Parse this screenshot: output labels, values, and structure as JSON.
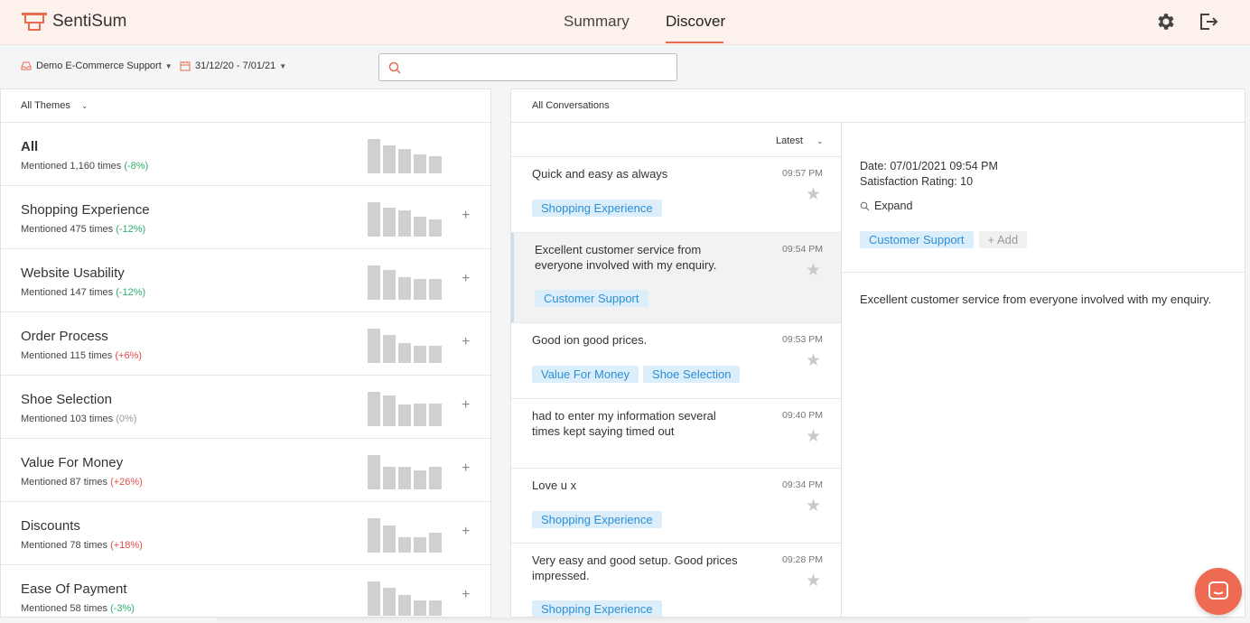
{
  "app": {
    "name": "SentiSum"
  },
  "nav": {
    "tabs": [
      {
        "label": "Summary"
      },
      {
        "label": "Discover"
      }
    ],
    "active": "Discover"
  },
  "filters": {
    "source": "Demo E-Commerce Support",
    "date_range": "31/12/20 - 7/01/21",
    "search_value": "",
    "search_placeholder": ""
  },
  "themes": {
    "header": "All Themes",
    "items": [
      {
        "name": "All",
        "count": "Mentioned 1,160 times",
        "delta": "(-8%)",
        "bars": [
          1.0,
          0.82,
          0.72,
          0.55,
          0.5
        ]
      },
      {
        "name": "Shopping Experience",
        "count": "Mentioned 475 times",
        "delta": "(-12%)",
        "bars": [
          1.0,
          0.85,
          0.75,
          0.58,
          0.5
        ]
      },
      {
        "name": "Website Usability",
        "count": "Mentioned 147 times",
        "delta": "(-12%)",
        "bars": [
          1.0,
          0.88,
          0.66,
          0.6,
          0.6
        ]
      },
      {
        "name": "Order Process",
        "count": "Mentioned 115 times",
        "delta": "(+6%)",
        "bars": [
          1.0,
          0.82,
          0.58,
          0.5,
          0.5
        ]
      },
      {
        "name": "Shoe Selection",
        "count": "Mentioned 103 times",
        "delta": "(0%)",
        "bars": [
          1.0,
          0.9,
          0.62,
          0.66,
          0.66
        ]
      },
      {
        "name": "Value For Money",
        "count": "Mentioned 87 times",
        "delta": "(+26%)",
        "bars": [
          1.0,
          0.66,
          0.66,
          0.55,
          0.66
        ]
      },
      {
        "name": "Discounts",
        "count": "Mentioned 78 times",
        "delta": "(+18%)",
        "bars": [
          1.0,
          0.8,
          0.45,
          0.45,
          0.58
        ]
      },
      {
        "name": "Ease Of Payment",
        "count": "Mentioned 58 times",
        "delta": "(-3%)",
        "bars": [
          1.0,
          0.82,
          0.6,
          0.45,
          0.45
        ]
      }
    ]
  },
  "conversations": {
    "header": "All Conversations",
    "sort": "Latest",
    "items": [
      {
        "text": "Quick and easy as always",
        "time": "09:57 PM",
        "tags": [
          "Shopping Experience"
        ]
      },
      {
        "text": "Excellent customer service from everyone involved with my enquiry.",
        "time": "09:54 PM",
        "tags": [
          "Customer Support"
        ]
      },
      {
        "text": "Good ion good prices.",
        "time": "09:53 PM",
        "tags": [
          "Value For Money",
          "Shoe Selection"
        ]
      },
      {
        "text": "had to enter my information several times kept saying timed out",
        "time": "09:40 PM",
        "tags": []
      },
      {
        "text": "Love u x",
        "time": "09:34 PM",
        "tags": [
          "Shopping Experience"
        ]
      },
      {
        "text": "Very easy and good setup. Good prices impressed.",
        "time": "09:28 PM",
        "tags": [
          "Shopping Experience"
        ]
      }
    ]
  },
  "detail": {
    "date": "Date: 07/01/2021 09:54 PM",
    "rating": "Satisfaction Rating: 10",
    "expand_label": "Expand",
    "tags": [
      "Customer Support"
    ],
    "add_label": "+ Add",
    "body": "Excellent customer service from everyone involved with my enquiry."
  },
  "colors": {
    "accent": "#ea6b50",
    "tag_bg": "#ddeefb",
    "tag_text": "#2b8fd6",
    "negative_delta": "#2eaf6e",
    "positive_delta": "#e44a4a"
  },
  "icons": [
    "logo-icon",
    "settings-gear-icon",
    "logout-icon",
    "inbox-icon",
    "calendar-icon",
    "search-icon",
    "star-icon",
    "chat-icon"
  ]
}
